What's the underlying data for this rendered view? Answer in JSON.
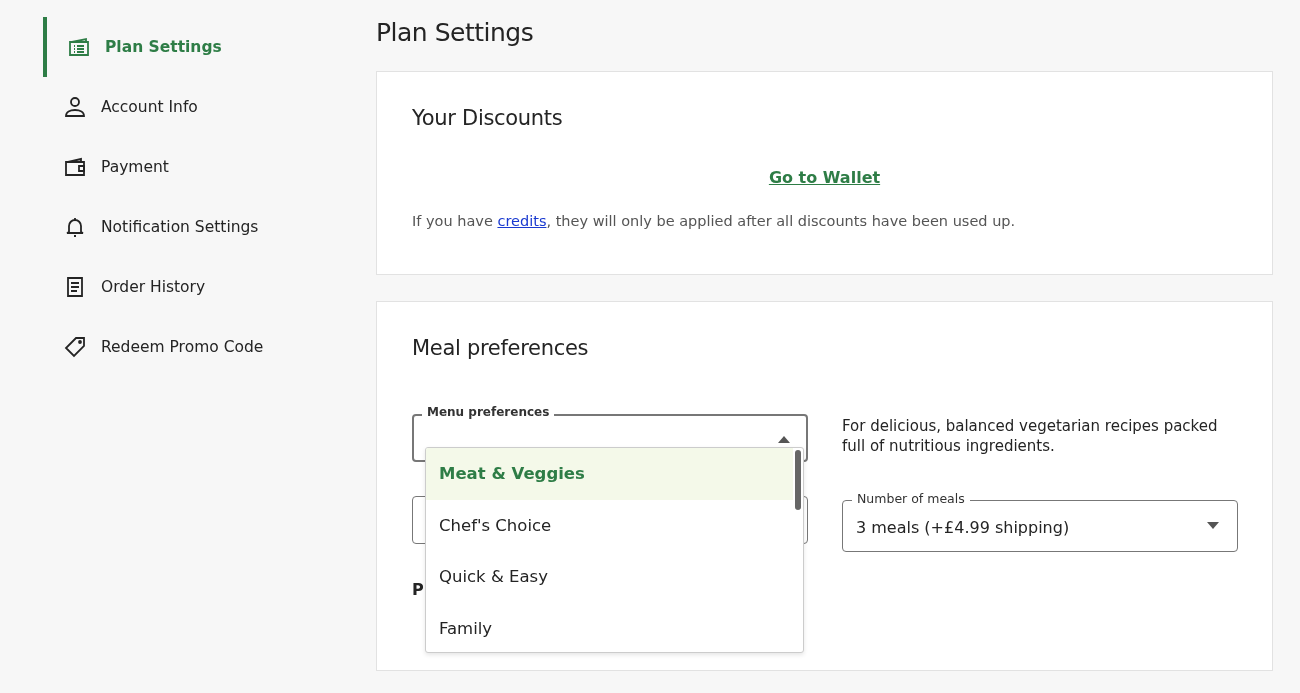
{
  "sidebar": {
    "items": [
      {
        "label": "Plan Settings",
        "selected": true
      },
      {
        "label": "Account Info",
        "selected": false
      },
      {
        "label": "Payment",
        "selected": false
      },
      {
        "label": "Notification Settings",
        "selected": false
      },
      {
        "label": "Order History",
        "selected": false
      },
      {
        "label": "Redeem Promo Code",
        "selected": false
      }
    ]
  },
  "page_title": "Plan Settings",
  "discounts": {
    "title": "Your Discounts",
    "wallet_link": "Go to Wallet",
    "note_before": "If you have ",
    "note_link": "credits",
    "note_after": ", they will only be applied after all discounts have been used up."
  },
  "meal_preferences": {
    "title": "Meal preferences",
    "menu_select": {
      "label": "Menu preferences",
      "expanded": true,
      "options": [
        {
          "label": "Meat & Veggies",
          "selected": true
        },
        {
          "label": "Chef's Choice",
          "selected": false
        },
        {
          "label": "Quick & Easy",
          "selected": false
        },
        {
          "label": "Family",
          "selected": false
        }
      ]
    },
    "description": "For delicious, balanced vegetarian recipes packed full of nutritious ingredients.",
    "meals_select": {
      "label": "Number of meals",
      "value": "3 meals (+£4.99 shipping)"
    },
    "partial_heading": "P"
  }
}
